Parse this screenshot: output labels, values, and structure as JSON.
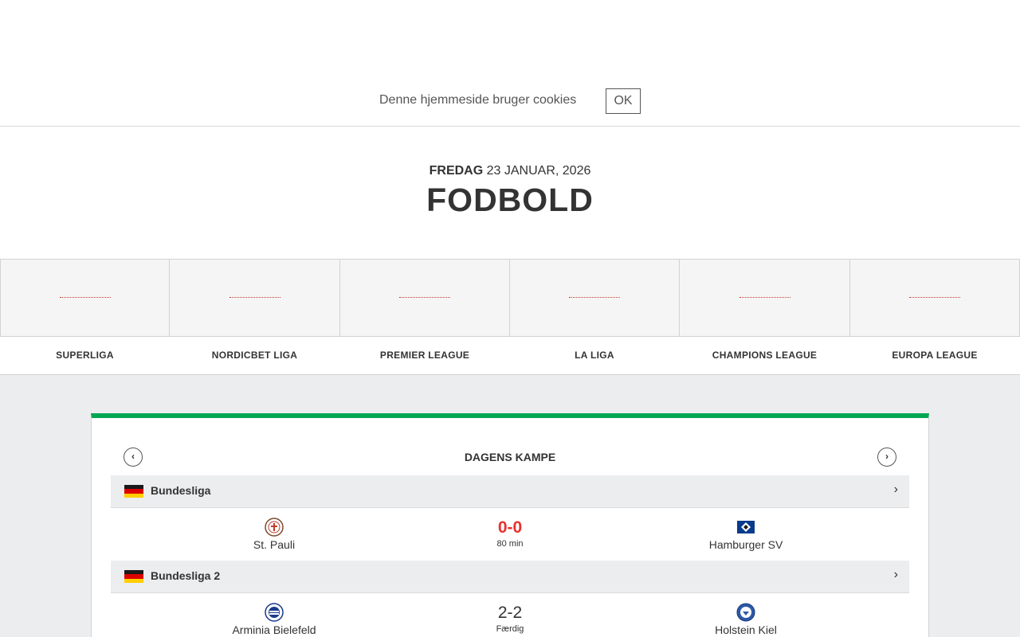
{
  "cookie": {
    "text": "Denne hjemmeside bruger cookies",
    "ok_label": "OK"
  },
  "header": {
    "day": "FREDAG",
    "date": "23 JANUAR, 2026",
    "title": "FODBOLD"
  },
  "league_nav": [
    {
      "label": "SUPERLIGA"
    },
    {
      "label": "NORDICBET LIGA"
    },
    {
      "label": "PREMIER LEAGUE"
    },
    {
      "label": "LA LIGA"
    },
    {
      "label": "CHAMPIONS LEAGUE"
    },
    {
      "label": "EUROPA LEAGUE"
    }
  ],
  "todays_matches": {
    "title": "DAGENS KAMPE",
    "prev_icon": "chevron-left-icon",
    "next_icon": "chevron-right-icon",
    "groups": [
      {
        "league": "Bundesliga",
        "flag": "germany-flag",
        "match": {
          "home": "St. Pauli",
          "away": "Hamburger SV",
          "score": "0-0",
          "status": "80 min",
          "live": true
        }
      },
      {
        "league": "Bundesliga 2",
        "flag": "germany-flag",
        "match": {
          "home": "Arminia Bielefeld",
          "away": "Holstein Kiel",
          "score": "2-2",
          "status": "Færdig",
          "live": false
        }
      }
    ]
  },
  "colors": {
    "accent_green": "#00a651",
    "live_red": "#e8302e",
    "background_grey": "#ecedef"
  }
}
